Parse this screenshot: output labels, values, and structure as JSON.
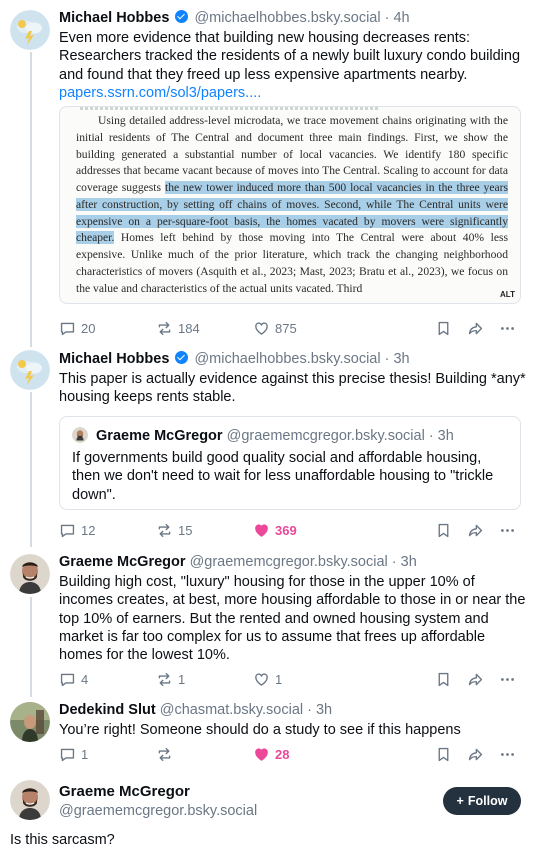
{
  "posts": [
    {
      "author": "Michael Hobbes",
      "handle": "@michaelhobbes.bsky.social",
      "time": "· 4h",
      "text": "Even more evidence that building new housing decreases rents: Researchers tracked the residents of a newly built luxury condo building and found that they freed up less expensive apartments nearby.",
      "link": "papers.ssrn.com/sol3/papers....",
      "image": {
        "cut_line": "and potential intermediary holding positions elsewhere.",
        "p_before": "Using detailed address-level microdata, we trace movement chains originating with the initial residents of The Central and document three main findings. First, we show the building generated a substantial number of local vacancies. We identify 180 specific addresses that became vacant because of moves into The Central. Scaling to account for data coverage suggests",
        "p_highlight": "the new tower induced more than 500 local vacancies in the three years after construction, by setting off chains of moves. Second, while The Central units were expensive on a per-square-foot basis, the homes vacated by movers were significantly cheaper.",
        "p_after": "Homes left behind by those moving into The Central were about 40% less expensive. Unlike much of the prior literature, which track the changing neighborhood characteristics of movers (Asquith et al., 2023; Mast, 2023; Bratu et al., 2023), we focus on the value and characteristics of the actual units vacated. Third",
        "alt": "ALT"
      },
      "replies": "20",
      "reposts": "184",
      "likes": "875"
    },
    {
      "author": "Michael Hobbes",
      "handle": "@michaelhobbes.bsky.social",
      "time": "· 3h",
      "text": "This paper is actually evidence against this precise thesis! Building *any* housing keeps rents stable.",
      "quote": {
        "author": "Graeme McGregor",
        "handle": "@graememcgregor.bsky.social",
        "time": "· 3h",
        "text": "If governments build good quality social and affordable housing, then we don't need to wait for less unaffordable housing to \"trickle down\"."
      },
      "replies": "12",
      "reposts": "15",
      "likes": "369"
    },
    {
      "author": "Graeme McGregor",
      "handle": "@graememcgregor.bsky.social",
      "time": "· 3h",
      "text": "Building high cost, \"luxury\" housing for those in the upper 10% of incomes creates, at best, more housing affordable to those in or near the top 10% of earners. But the rented and owned housing system and market is far too complex for us to assume that frees up affordable homes for the lowest 10%.",
      "replies": "4",
      "reposts": "1",
      "likes": "1"
    },
    {
      "author": "Dedekind Slut",
      "handle": "@chasmat.bsky.social",
      "time": "· 3h",
      "text": "You’re right! Someone should do a study to see if this happens",
      "replies": "1",
      "reposts": "",
      "likes": "28"
    }
  ],
  "main": {
    "author": "Graeme McGregor",
    "handle": "@graememcgregor.bsky.social",
    "follow_label": "Follow",
    "text": "Is this sarcasm?"
  },
  "colors": {
    "accent": "#1083fe",
    "like": "#ec4899",
    "muted": "#6b7785",
    "highlight": "#a9cfe8"
  },
  "icons": [
    "verified-badge-icon",
    "reply-icon",
    "repost-icon",
    "like-icon",
    "bookmark-icon",
    "share-icon",
    "more-icon",
    "plus-icon"
  ]
}
